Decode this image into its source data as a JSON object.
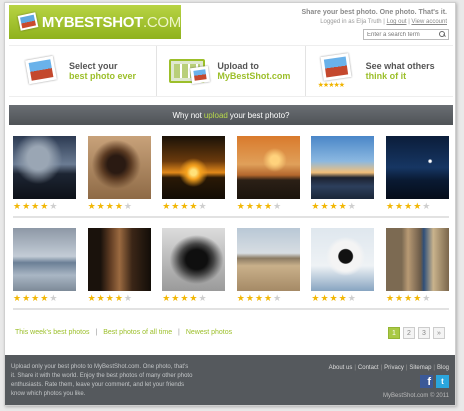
{
  "header": {
    "logo_text_bold": "MYBESTSHOT",
    "logo_text_light": ".COM",
    "tagline": "Share your best photo. One photo. That's it.",
    "login_prefix": "Logged in as Elja Truth |",
    "logout": "Log out",
    "sep": "|",
    "view_account": "View account",
    "search_placeholder": "Enter a search term"
  },
  "steps": [
    {
      "line1": "Select your",
      "line2": "best photo ever",
      "icon": "photo-icon"
    },
    {
      "line1": "Upload to",
      "line2": "MyBestShot.com",
      "icon": "upload-monitor-icon"
    },
    {
      "line1": "See what others",
      "line2": "think of it",
      "icon": "rated-photo-icon",
      "stars": "★★★★★"
    }
  ],
  "banner": {
    "prefix": "Why not",
    "link": "upload",
    "suffix": "your best photo?"
  },
  "photos_row1": [
    {
      "name": "photo-clouds",
      "rating": 4
    },
    {
      "name": "photo-monkey",
      "rating": 4
    },
    {
      "name": "photo-sunset",
      "rating": 4
    },
    {
      "name": "photo-lake-sunset",
      "rating": 4
    },
    {
      "name": "photo-coast-dusk",
      "rating": 4
    },
    {
      "name": "photo-night-sky",
      "rating": 4
    }
  ],
  "photos_row2": [
    {
      "name": "photo-misty-sea",
      "rating": 4
    },
    {
      "name": "photo-barn-interior",
      "rating": 4
    },
    {
      "name": "photo-chimpanzee",
      "rating": 4
    },
    {
      "name": "photo-desert",
      "rating": 4
    },
    {
      "name": "photo-bird",
      "rating": 4
    },
    {
      "name": "photo-street",
      "rating": 4
    }
  ],
  "links": {
    "week": "This week's best photos",
    "sep": "|",
    "all_time": "Best photos of all time",
    "newest": "Newest photos"
  },
  "pager": [
    "1",
    "2",
    "3",
    "»"
  ],
  "footer": {
    "description": "Upload only your best photo to MyBestShot.com. One photo, that's it. Share it with the world. Enjoy the best photos of many other photo enthusiasts. Rate them, leave your comment, and let your friends know which photos you like.",
    "nav": [
      "About us",
      "Contact",
      "Privacy",
      "Sitemap",
      "Blog"
    ],
    "sep": "|",
    "facebook": "f",
    "twitter": "t",
    "copyright": "MyBestShot.com © 2011"
  },
  "colors": {
    "accent_green": "#9cbf2a",
    "banner_gray": "#54585c",
    "star_yellow": "#f2b705"
  }
}
